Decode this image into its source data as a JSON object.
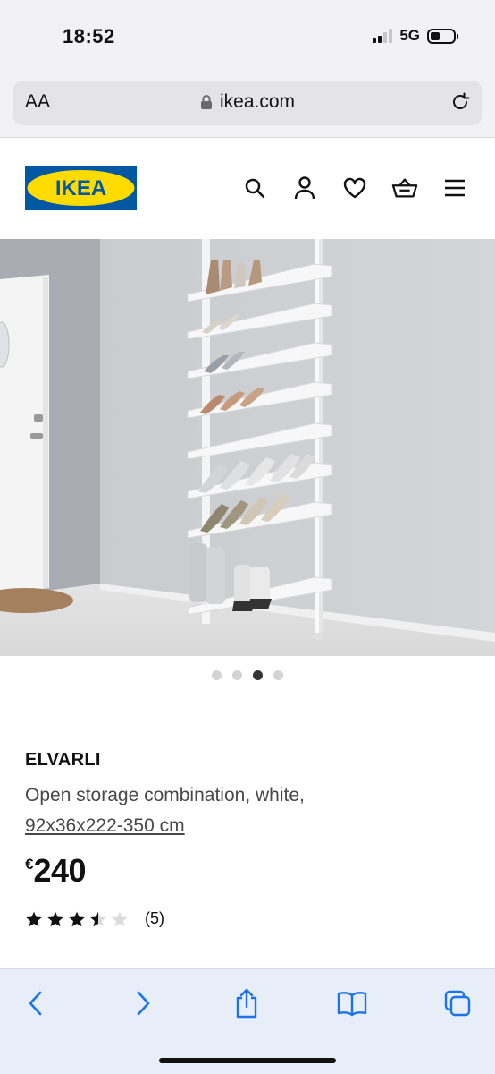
{
  "status": {
    "time": "18:52",
    "network": "5G"
  },
  "browser": {
    "text_size_label": "AA",
    "url": "ikea.com"
  },
  "site": {
    "brand": "IKEA",
    "brand_colors": {
      "blue": "#0058a3",
      "yellow": "#ffdb00"
    },
    "icons": [
      "search-icon",
      "account-icon",
      "heart-icon",
      "basket-icon",
      "menu-icon"
    ]
  },
  "carousel": {
    "total": 4,
    "active_index": 2
  },
  "product": {
    "name": "ELVARLI",
    "description_line1": "Open storage combination, white,",
    "description_line2": "92x36x222-350 cm",
    "currency": "€",
    "price": "240",
    "rating_value": 3.5,
    "rating_max": 5,
    "review_count": "(5)"
  },
  "toolbar": {
    "icons": [
      "back-icon",
      "forward-icon",
      "share-icon",
      "bookmarks-icon",
      "tabs-icon"
    ],
    "accent": "#1a73e8"
  }
}
